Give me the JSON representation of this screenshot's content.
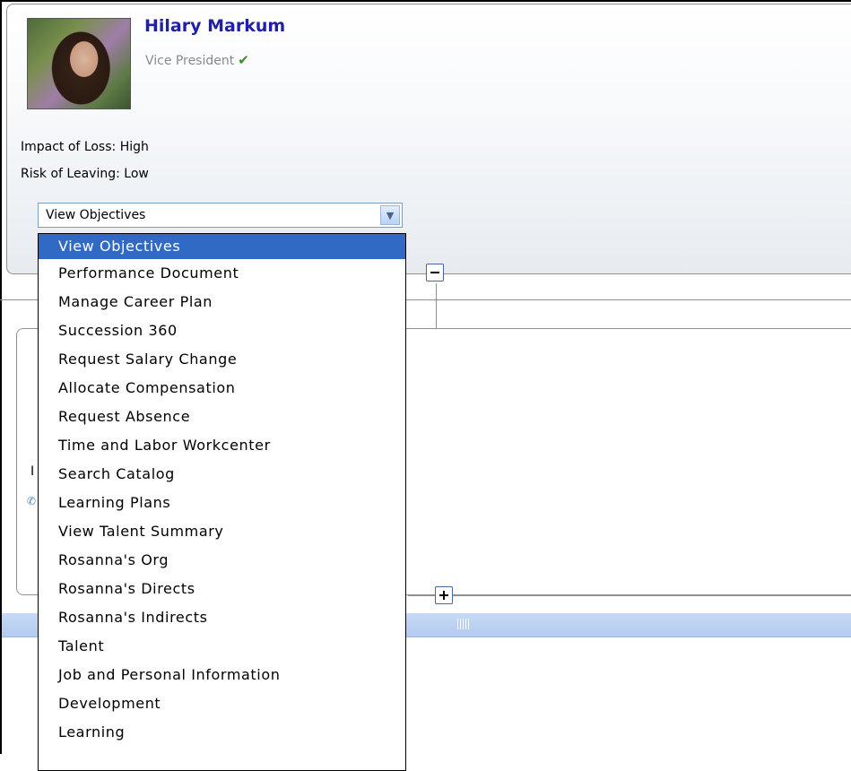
{
  "profile": {
    "name": "Hilary Markum",
    "title": "Vice President",
    "check": "✔",
    "impact_of_loss": "Impact of Loss: High",
    "risk_of_leaving": "Risk of Leaving: Low"
  },
  "actions_select": {
    "selected": "View Objectives",
    "arrow": "▼",
    "options": [
      "View Objectives",
      "Performance Document",
      "Manage Career Plan",
      "Succession 360",
      "Request Salary Change",
      "Allocate Compensation",
      "Request Absence",
      "Time and Labor Workcenter",
      "Search Catalog",
      "Learning Plans",
      "View Talent Summary",
      "Rosanna's Org",
      "Rosanna's Directs",
      "Rosanna's Indirects",
      "Talent",
      "Job and Personal Information",
      "Development",
      "Learning"
    ]
  },
  "second_card": {
    "partial_label": "I",
    "phone_icon": "phone-icon"
  },
  "colors": {
    "name": "#1f1fa8",
    "selected_option": "#316ac5",
    "splitter": "#c7d9f4"
  }
}
